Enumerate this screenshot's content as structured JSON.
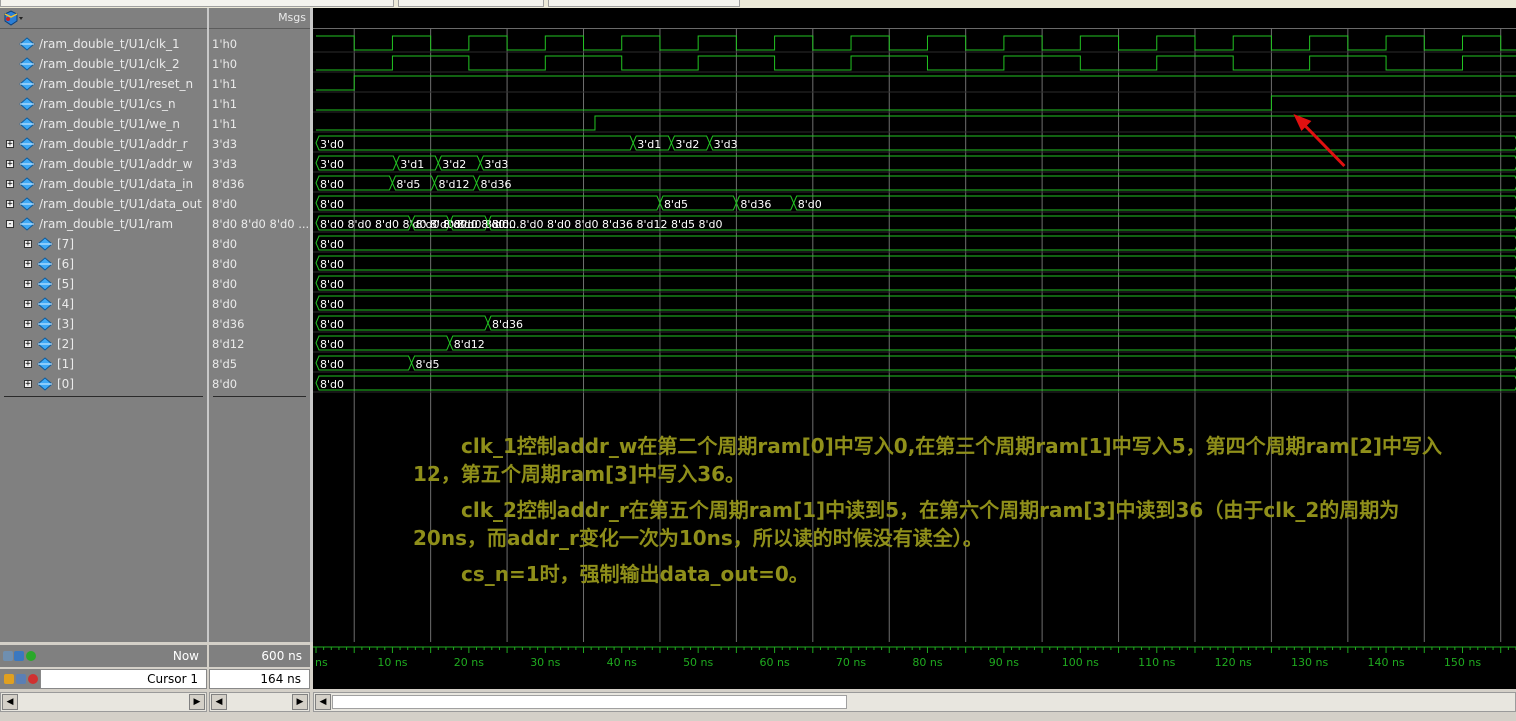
{
  "header": {
    "msgs_label": "Msgs"
  },
  "colors": {
    "wave": "#22c322",
    "text": "#eaeaea",
    "annotation": "#8f8f1a",
    "arrow": "#e01010",
    "cursor_line": "#c8c8c8",
    "axis": "#1faa1f"
  },
  "signals": [
    {
      "name": "/ram_double_t/U1/clk_1",
      "value": "1'h0",
      "expandable": false,
      "indent": 0
    },
    {
      "name": "/ram_double_t/U1/clk_2",
      "value": "1'h0",
      "expandable": false,
      "indent": 0
    },
    {
      "name": "/ram_double_t/U1/reset_n",
      "value": "1'h1",
      "expandable": false,
      "indent": 0
    },
    {
      "name": "/ram_double_t/U1/cs_n",
      "value": "1'h1",
      "expandable": false,
      "indent": 0
    },
    {
      "name": "/ram_double_t/U1/we_n",
      "value": "1'h1",
      "expandable": false,
      "indent": 0
    },
    {
      "name": "/ram_double_t/U1/addr_r",
      "value": "3'd3",
      "expandable": true,
      "indent": 0,
      "expanded": false
    },
    {
      "name": "/ram_double_t/U1/addr_w",
      "value": "3'd3",
      "expandable": true,
      "indent": 0,
      "expanded": false
    },
    {
      "name": "/ram_double_t/U1/data_in",
      "value": "8'd36",
      "expandable": true,
      "indent": 0,
      "expanded": false
    },
    {
      "name": "/ram_double_t/U1/data_out",
      "value": "8'd0",
      "expandable": true,
      "indent": 0,
      "expanded": false
    },
    {
      "name": "/ram_double_t/U1/ram",
      "value": "8'd0 8'd0 8'd0 ...",
      "expandable": true,
      "indent": 0,
      "expanded": true
    },
    {
      "name": "[7]",
      "value": "8'd0",
      "expandable": true,
      "indent": 1,
      "expanded": false
    },
    {
      "name": "[6]",
      "value": "8'd0",
      "expandable": true,
      "indent": 1,
      "expanded": false
    },
    {
      "name": "[5]",
      "value": "8'd0",
      "expandable": true,
      "indent": 1,
      "expanded": false
    },
    {
      "name": "[4]",
      "value": "8'd0",
      "expandable": true,
      "indent": 1,
      "expanded": false
    },
    {
      "name": "[3]",
      "value": "8'd36",
      "expandable": true,
      "indent": 1,
      "expanded": false
    },
    {
      "name": "[2]",
      "value": "8'd12",
      "expandable": true,
      "indent": 1,
      "expanded": false
    },
    {
      "name": "[1]",
      "value": "8'd5",
      "expandable": true,
      "indent": 1,
      "expanded": false
    },
    {
      "name": "[0]",
      "value": "8'd0",
      "expandable": true,
      "indent": 1,
      "expanded": false
    }
  ],
  "waveforms": {
    "view_start_ns": 0,
    "view_end_ns": 157,
    "clk_1": {
      "type": "bit",
      "initial": 1,
      "transitions": [
        5,
        10,
        15,
        20,
        25,
        30,
        35,
        40,
        45,
        50,
        55,
        60,
        65,
        70,
        75,
        80,
        85,
        90,
        95,
        100,
        105,
        110,
        115,
        120,
        125,
        130,
        135,
        140,
        145,
        150,
        155
      ]
    },
    "clk_2": {
      "type": "bit",
      "initial": 0,
      "transitions": [
        10,
        20,
        30,
        40,
        50,
        60,
        70,
        80,
        90,
        100,
        110,
        120,
        130,
        140,
        150
      ]
    },
    "reset_n": {
      "type": "bit",
      "initial": 0,
      "transitions": [
        5
      ]
    },
    "cs_n": {
      "type": "bit",
      "initial": 0,
      "transitions": [
        125
      ]
    },
    "we_n": {
      "type": "bit",
      "initial": 0,
      "transitions": [
        36.5
      ]
    },
    "addr_r": {
      "type": "bus",
      "segments": [
        {
          "t": 0,
          "v": "3'd0"
        },
        {
          "t": 41.5,
          "v": "3'd1"
        },
        {
          "t": 46.5,
          "v": "3'd2"
        },
        {
          "t": 51.5,
          "v": "3'd3"
        }
      ]
    },
    "addr_w": {
      "type": "bus",
      "segments": [
        {
          "t": 0,
          "v": "3'd0"
        },
        {
          "t": 10.5,
          "v": "3'd1"
        },
        {
          "t": 16,
          "v": "3'd2"
        },
        {
          "t": 21.5,
          "v": "3'd3"
        }
      ]
    },
    "data_in": {
      "type": "bus",
      "segments": [
        {
          "t": 0,
          "v": "8'd0"
        },
        {
          "t": 10,
          "v": "8'd5"
        },
        {
          "t": 15.5,
          "v": "8'd12"
        },
        {
          "t": 21,
          "v": "8'd36"
        }
      ]
    },
    "data_out": {
      "type": "bus",
      "segments": [
        {
          "t": 0,
          "v": "8'd0"
        },
        {
          "t": 45,
          "v": "8'd5"
        },
        {
          "t": 55,
          "v": "8'd36"
        },
        {
          "t": 62.5,
          "v": "8'd0"
        }
      ]
    },
    "ram": {
      "type": "bus",
      "segments": [
        {
          "t": 0,
          "v": "8'd0 8'd0 8'd0 8'd0 8'd0 8'd0 8'd0 ..."
        },
        {
          "t": 12.5,
          "v": "8'd0 8'd0..."
        },
        {
          "t": 17.5,
          "v": "8'd0 8'd0..."
        },
        {
          "t": 22.5,
          "v": "8'd0 8'd0 8'd0 8'd0 8'd36 8'd12 8'd5 8'd0"
        }
      ]
    },
    "ram7": {
      "type": "bus",
      "segments": [
        {
          "t": 0,
          "v": "8'd0"
        }
      ]
    },
    "ram6": {
      "type": "bus",
      "segments": [
        {
          "t": 0,
          "v": "8'd0"
        }
      ]
    },
    "ram5": {
      "type": "bus",
      "segments": [
        {
          "t": 0,
          "v": "8'd0"
        }
      ]
    },
    "ram4": {
      "type": "bus",
      "segments": [
        {
          "t": 0,
          "v": "8'd0"
        }
      ]
    },
    "ram3": {
      "type": "bus",
      "segments": [
        {
          "t": 0,
          "v": "8'd0"
        },
        {
          "t": 22.5,
          "v": "8'd36"
        }
      ]
    },
    "ram2": {
      "type": "bus",
      "segments": [
        {
          "t": 0,
          "v": "8'd0"
        },
        {
          "t": 17.5,
          "v": "8'd12"
        }
      ]
    },
    "ram1": {
      "type": "bus",
      "segments": [
        {
          "t": 0,
          "v": "8'd0"
        },
        {
          "t": 12.5,
          "v": "8'd5"
        }
      ]
    },
    "ram0": {
      "type": "bus",
      "segments": [
        {
          "t": 0,
          "v": "8'd0"
        }
      ]
    }
  },
  "time_axis": {
    "labels": [
      "ns",
      "10 ns",
      "20 ns",
      "30 ns",
      "40 ns",
      "50 ns",
      "60 ns",
      "70 ns",
      "80 ns",
      "90 ns",
      "100 ns",
      "110 ns",
      "120 ns",
      "130 ns",
      "140 ns",
      "150 ns"
    ],
    "label_times": [
      0,
      10,
      20,
      30,
      40,
      50,
      60,
      70,
      80,
      90,
      100,
      110,
      120,
      130,
      140,
      150
    ]
  },
  "gridlines_ns": [
    5,
    15,
    25,
    35,
    45,
    55,
    65,
    75,
    85,
    95,
    105,
    115,
    125,
    135,
    145,
    155
  ],
  "annotation": {
    "p1": "clk_1控制addr_w在第二个周期ram[0]中写入0,在第三个周期ram[1]中写入5，第四个周期ram[2]中写入12，第五个周期ram[3]中写入36。",
    "p2": "clk_2控制addr_r在第五个周期ram[1]中读到5，在第六个周期ram[3]中读到36（由于clk_2的周期为20ns，而addr_r变化一次为10ns，所以读的时候没有读全）。",
    "p3": "cs_n=1时，强制输出data_out=0。"
  },
  "status": {
    "now_label": "Now",
    "now_value": "600 ns",
    "cursor_label": "Cursor 1",
    "cursor_value": "164 ns"
  },
  "scrollbar": {
    "position": 0.0
  }
}
